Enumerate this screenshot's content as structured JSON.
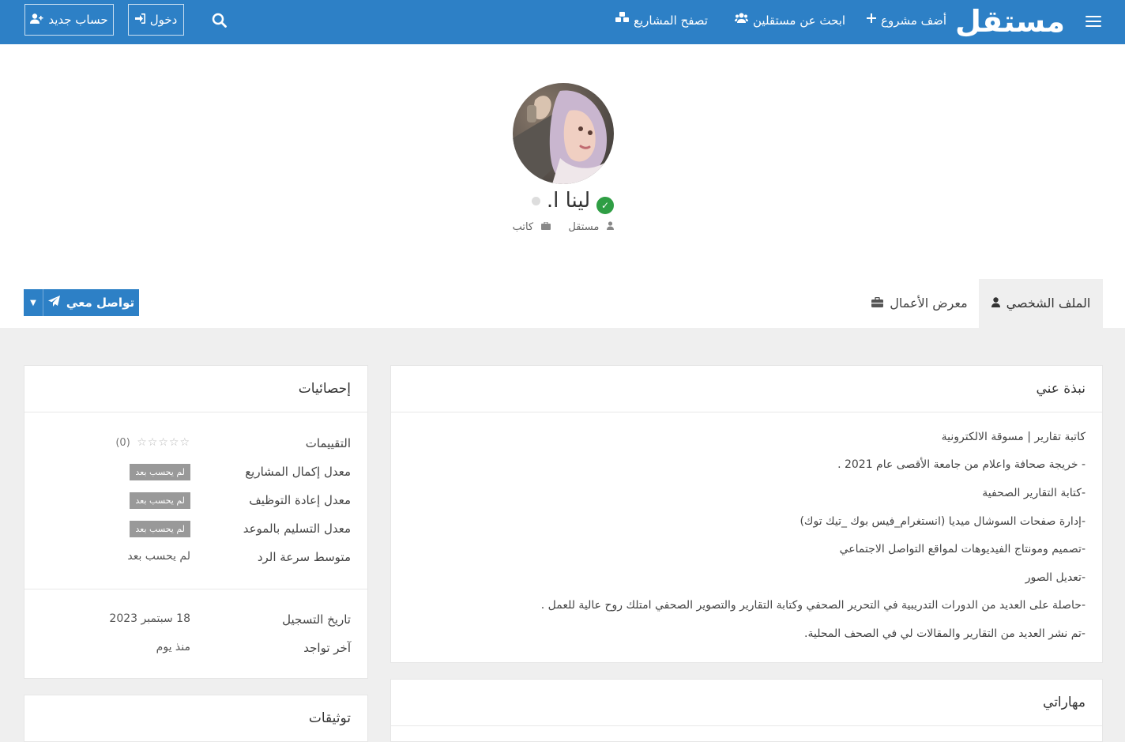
{
  "nav": {
    "brand": "مستقل",
    "add_project": "أضف مشروع",
    "find_freelancers": "ابحث عن مستقلين",
    "browse_projects": "تصفح المشاريع",
    "login": "دخول",
    "signup": "حساب جديد"
  },
  "profile": {
    "name": "لينا ا.",
    "role": "مستقل",
    "specialty": "كاتب"
  },
  "tabs": [
    {
      "label": "الملف الشخصي"
    },
    {
      "label": "معرض الأعمال"
    }
  ],
  "contact_button": "تواصل معي",
  "about": {
    "title": "نبذة عني",
    "lines": [
      "كاتبة تقارير | مسوقة الالكترونية",
      "- خريجة صحافة واعلام من جامعة الأقصى عام 2021 .",
      "-كتابة التقارير الصحفية",
      "-إدارة صفحات السوشال ميديا (انستغرام_فيس بوك _تيك توك)",
      "-تصميم ومونتاج الفيديوهات لمواقع التواصل الاجتماعي",
      "-تعديل الصور",
      "-حاصلة على العديد من الدورات التدريبية في التحرير الصحفي وكتابة التقارير والتصوير الصحفي امتلك روح عالية للعمل .",
      "-تم نشر العديد من التقارير والمقالات لي في الصحف المحلية."
    ]
  },
  "skills": {
    "title": "مهاراتي"
  },
  "stats": {
    "title": "إحصائيات",
    "ratings_label": "التقييمات",
    "ratings_count": "(0)",
    "completion_label": "معدل إكمال المشاريع",
    "rehire_label": "معدل إعادة التوظيف",
    "ontime_label": "معدل التسليم بالموعد",
    "not_calculated_badge": "لم يحسب بعد",
    "response_label": "متوسط سرعة الرد",
    "response_value": "لم يحسب بعد",
    "registered_label": "تاريخ التسجيل",
    "registered_value": "18 سبتمبر 2023",
    "last_seen_label": "آخر تواجد",
    "last_seen_value": "منذ يوم"
  },
  "verifications": {
    "title": "توثيقات"
  }
}
